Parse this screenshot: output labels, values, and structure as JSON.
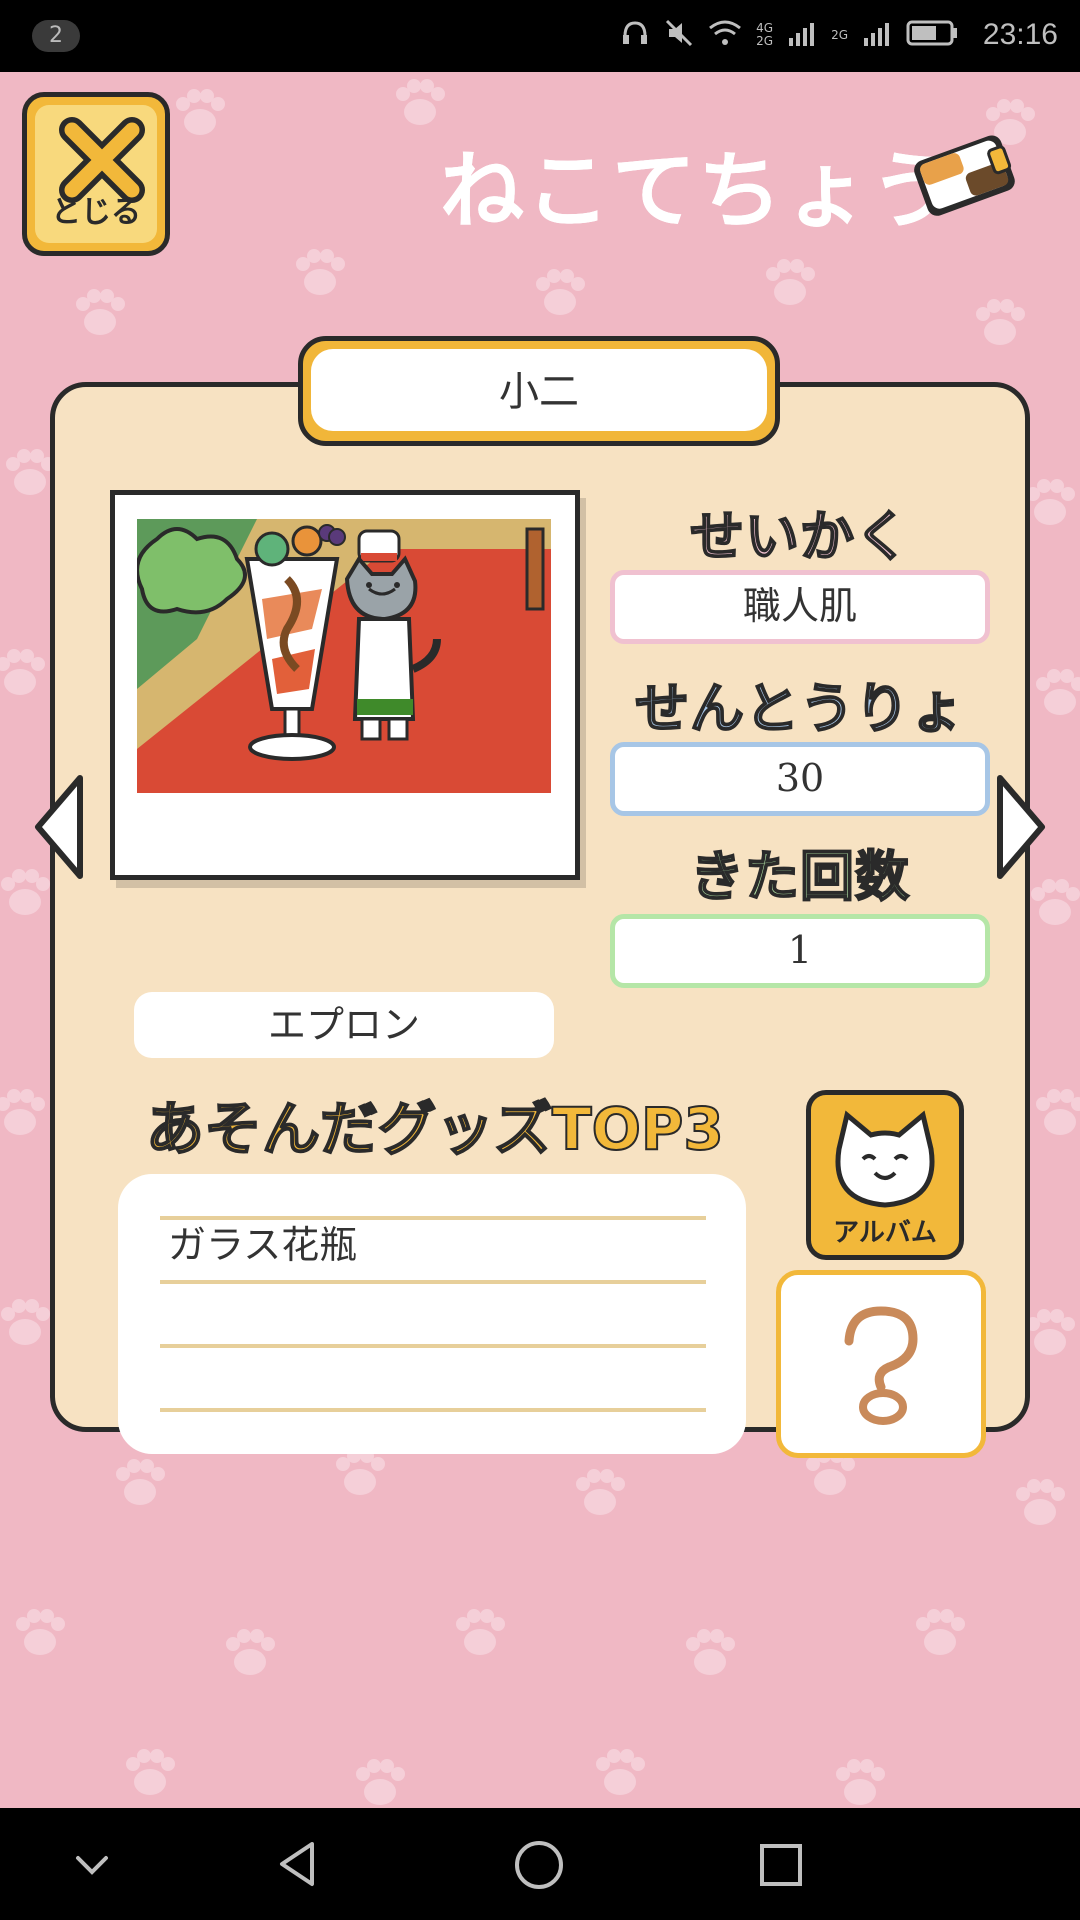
{
  "status_bar": {
    "notification_count": "2",
    "network_label_1": "4G",
    "network_label_2": "2G",
    "network_label_3": "2G",
    "time": "23:16"
  },
  "header": {
    "close_label": "とじる",
    "title": "ねこてちょう"
  },
  "cat": {
    "name": "小二",
    "goodie": "エプロン",
    "personality_label": "せいかく",
    "personality": "職人肌",
    "power_label": "せんとうりょく",
    "power": "30",
    "visits_label": "きた回数",
    "visits": "1"
  },
  "goods": {
    "title": "あそんだグッズTOP3",
    "items": [
      "ガラス花瓶",
      "",
      ""
    ]
  },
  "album": {
    "label": "アルバム"
  },
  "help": {
    "symbol": "?"
  },
  "colors": {
    "background": "#f0b8c4",
    "card": "#f7e2c2",
    "accent": "#f2b83a",
    "personality": "#f0c1d0",
    "power": "#a7c6e6",
    "visits": "#b5e6a7"
  },
  "icons": {
    "close": "x-icon",
    "book": "book-icon",
    "left": "arrow-left-icon",
    "right": "arrow-right-icon",
    "album": "cat-face-icon",
    "help": "question-icon"
  }
}
